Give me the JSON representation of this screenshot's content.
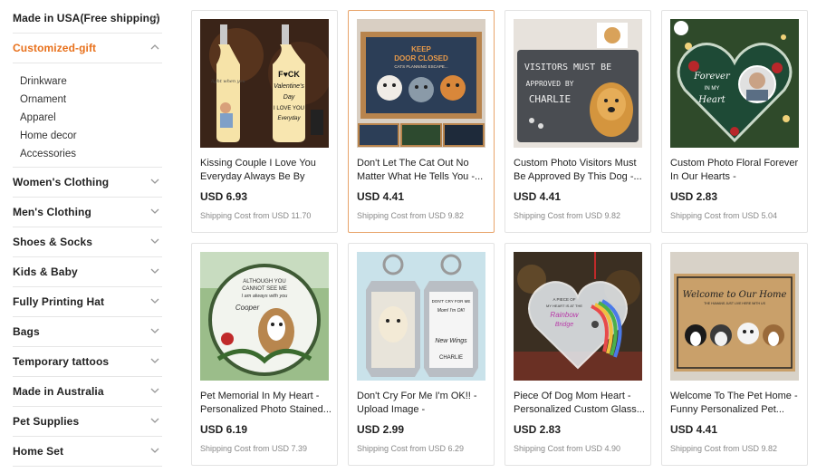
{
  "sidebar": {
    "categories": [
      {
        "label": "Made in USA(Free shipping)",
        "expanded": false
      },
      {
        "label": "Customized-gift",
        "expanded": true,
        "active": true,
        "subitems": [
          "Drinkware",
          "Ornament",
          "Apparel",
          "Home decor",
          "Accessories"
        ]
      },
      {
        "label": "Women's Clothing",
        "expanded": false
      },
      {
        "label": "Men's Clothing",
        "expanded": false
      },
      {
        "label": "Shoes & Socks",
        "expanded": false
      },
      {
        "label": "Kids & Baby",
        "expanded": false
      },
      {
        "label": "Fully Printing Hat",
        "expanded": false
      },
      {
        "label": "Bags",
        "expanded": false
      },
      {
        "label": "Temporary tattoos",
        "expanded": false
      },
      {
        "label": "Made in Australia",
        "expanded": false
      },
      {
        "label": "Pet Supplies",
        "expanded": false
      },
      {
        "label": "Home Set",
        "expanded": false
      }
    ]
  },
  "colors": {
    "accent": "#e8711c",
    "hover_border": "#e8a46a"
  },
  "products": [
    {
      "title": "Kissing Couple I Love You Everyday Always Be By Your...",
      "price": "USD 6.93",
      "shipping": "Shipping Cost from USD 11.70",
      "icon": "bottle-lamp-image"
    },
    {
      "title": "Don't Let The Cat Out No Matter What He Tells You -...",
      "price": "USD 4.41",
      "shipping": "Shipping Cost from USD 9.82",
      "icon": "cat-doormat-image",
      "hovered": true
    },
    {
      "title": "Custom Photo Visitors Must Be Approved By This Dog -...",
      "price": "USD 4.41",
      "shipping": "Shipping Cost from USD 9.82",
      "icon": "dog-doormat-image"
    },
    {
      "title": "Custom Photo Floral Forever In Our Hearts - Personalized...",
      "price": "USD 2.83",
      "shipping": "Shipping Cost from USD 5.04",
      "icon": "heart-ornament-image"
    },
    {
      "title": "Pet Memorial In My Heart - Personalized Photo Stained...",
      "price": "USD 6.19",
      "shipping": "Shipping Cost from USD 7.39",
      "icon": "suncatcher-image"
    },
    {
      "title": "Don't Cry For Me I'm OK!! - Upload Image - Personalized...",
      "price": "USD 2.99",
      "shipping": "Shipping Cost from USD 6.29",
      "icon": "keychain-image"
    },
    {
      "title": "Piece Of Dog Mom Heart - Personalized Custom Glass...",
      "price": "USD 2.83",
      "shipping": "Shipping Cost from USD 4.90",
      "icon": "glass-heart-image"
    },
    {
      "title": "Welcome To The Pet Home - Funny Personalized Pet...",
      "price": "USD 4.41",
      "shipping": "Shipping Cost from USD 9.82",
      "icon": "pet-doormat-image"
    }
  ],
  "thumb_text": {
    "bottle_left": "light when you",
    "bottle_right": [
      "F♥CK",
      "Valentine's",
      "Day",
      "I LOVE YOU",
      "Everyday"
    ],
    "cat_mat": [
      "KEEP",
      "DOOR CLOSED",
      "CATS PLANNING ESCAPE..."
    ],
    "dog_mat": [
      "VISITORS MUST BE",
      "APPROVED BY",
      "CHARLIE"
    ],
    "heart": [
      "Forever",
      "IN MY",
      "Heart"
    ],
    "suncatcher": [
      "ALTHOUGH YOU",
      "CANNOT SEE ME",
      "I am always with you",
      "Cooper"
    ],
    "keychain": [
      "DON'T CRY FOR ME",
      "Mom! I'm OK!",
      "New Wings",
      "CHARLIE"
    ],
    "glass_heart": [
      "A PIECE OF",
      "MY HEART IS AT THE",
      "Rainbow",
      "Bridge"
    ],
    "pet_mat": [
      "Welcome to Our Home",
      "THE HUMANS JUST LIVE HERE WITH US"
    ]
  }
}
